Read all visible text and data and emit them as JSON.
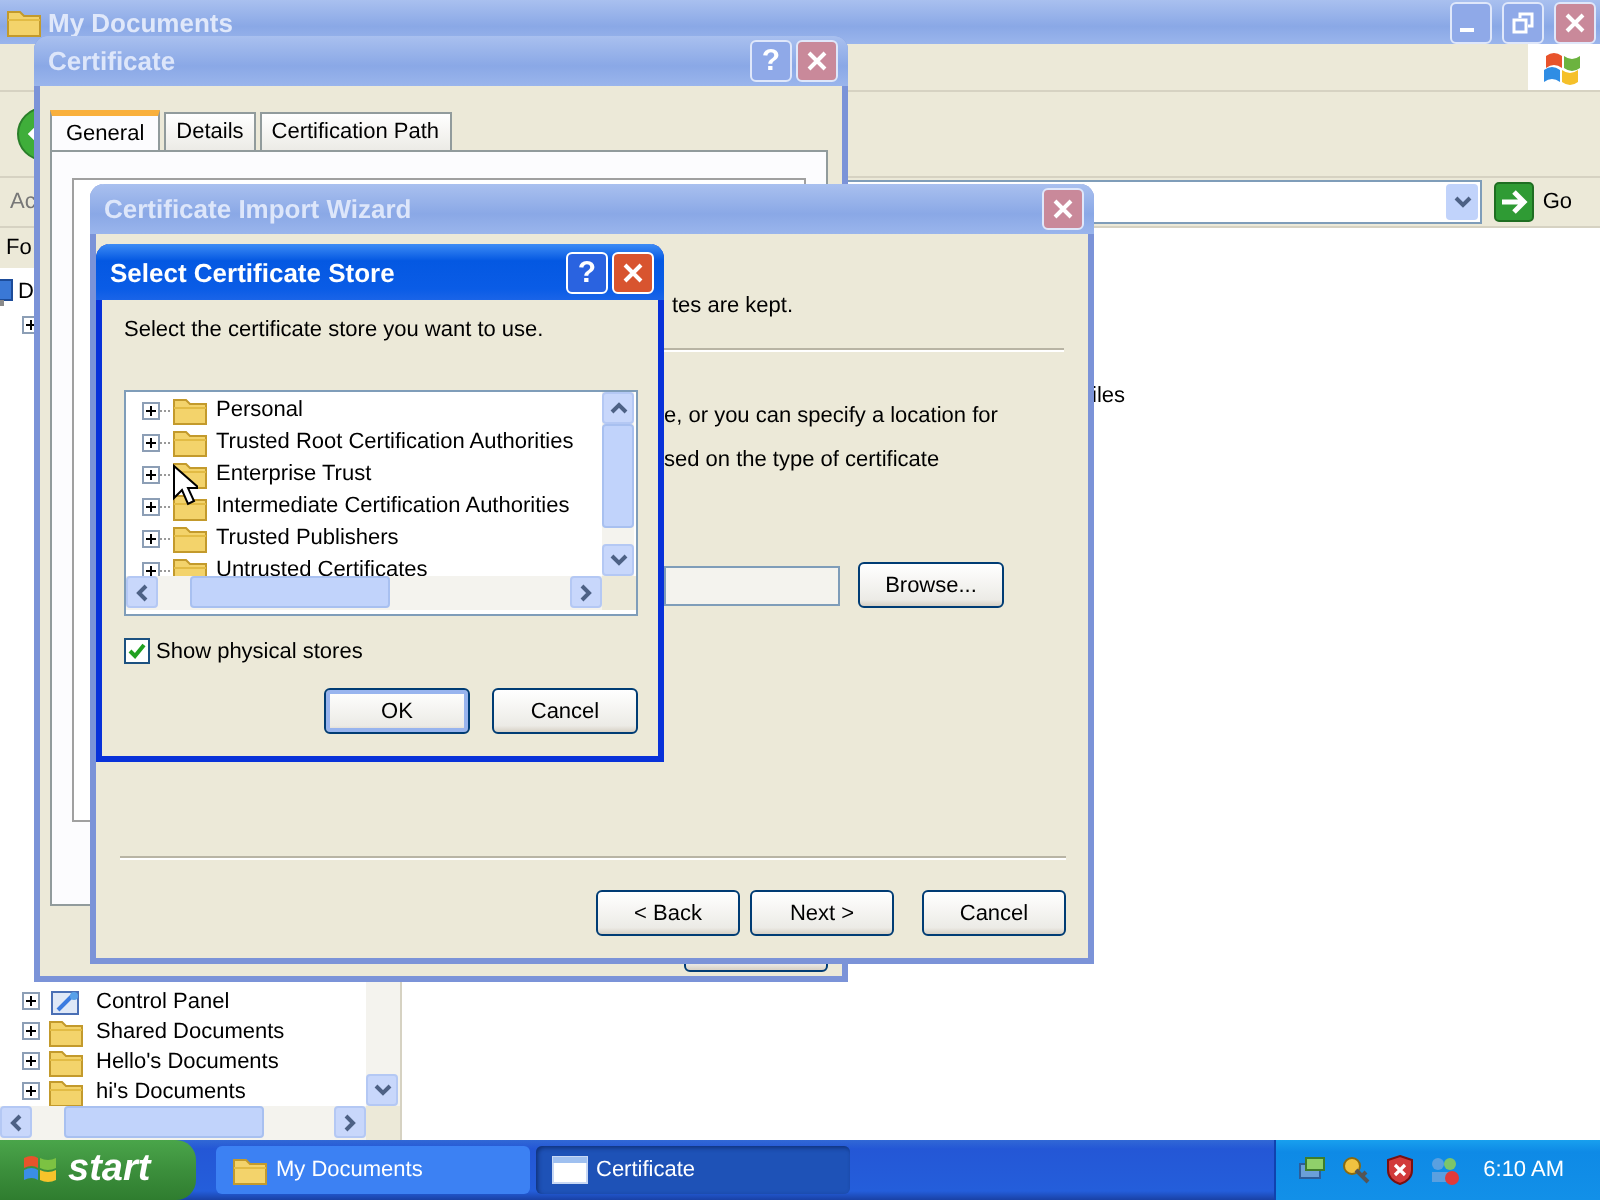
{
  "explorer": {
    "title": "My Documents",
    "address_label": "Ac",
    "go_button": "Go",
    "folders_label": "Fo",
    "top_item": "D",
    "tree": [
      {
        "label": "Control Panel",
        "kind": "panel",
        "expanded": false
      },
      {
        "label": "Shared Documents",
        "kind": "folder",
        "expanded": false
      },
      {
        "label": "Hello's Documents",
        "kind": "folder",
        "expanded": false
      },
      {
        "label": "hi's Documents",
        "kind": "folder",
        "expanded": false
      }
    ],
    "content_text": "iles"
  },
  "certificate": {
    "title": "Certificate",
    "help_button": "?",
    "tabs": [
      {
        "label": "General",
        "selected": true
      },
      {
        "label": "Details",
        "selected": false
      },
      {
        "label": "Certification Path",
        "selected": false
      }
    ]
  },
  "wizard": {
    "title": "Certificate Import Wizard",
    "header_text": "tes are kept.",
    "lines": [
      "e, or you can specify a location for",
      "sed on the type of certificate"
    ],
    "browse_button": "Browse...",
    "buttons": [
      "< Back",
      "Next >",
      "Cancel"
    ]
  },
  "store_dialog": {
    "title": "Select Certificate Store",
    "help_button": "?",
    "prompt": "Select the certificate store you want to use.",
    "stores": [
      {
        "label": "Personal",
        "expanded": false
      },
      {
        "label": "Trusted Root Certification Authorities",
        "expanded": false
      },
      {
        "label": "Enterprise Trust",
        "expanded": false
      },
      {
        "label": "Intermediate Certification Authorities",
        "expanded": false
      },
      {
        "label": "Trusted Publishers",
        "expanded": false
      },
      {
        "label": "Untrusted Certificates",
        "expanded": false
      }
    ],
    "show_physical_stores": {
      "label": "Show physical stores",
      "checked": true
    },
    "buttons": [
      "OK",
      "Cancel"
    ]
  },
  "taskbar": {
    "start": "start",
    "tasks": [
      {
        "label": "My Documents",
        "kind": "folder",
        "selected": false
      },
      {
        "label": "Certificate",
        "kind": "window",
        "selected": true
      }
    ],
    "clock": "6:10 AM"
  }
}
